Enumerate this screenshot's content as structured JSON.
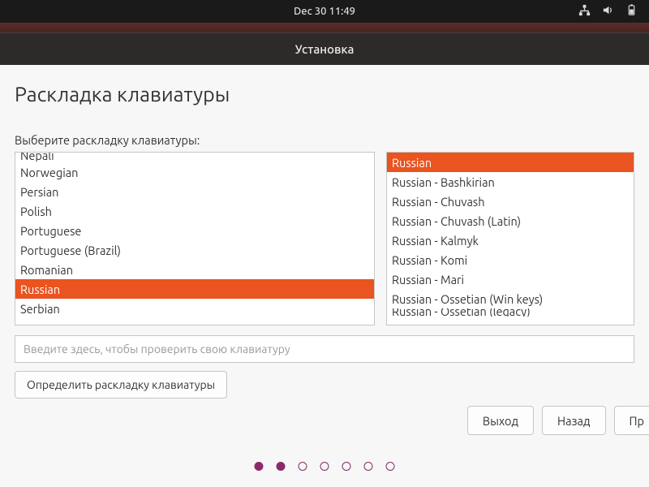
{
  "topbar": {
    "datetime": "Dec 30  11:49"
  },
  "window": {
    "title": "Установка"
  },
  "page": {
    "title": "Раскладка клавиатуры",
    "prompt": "Выберите раскладку клавиатуры:"
  },
  "left_list": {
    "selected_index": 7,
    "items": [
      "Nepali",
      "Norwegian",
      "Persian",
      "Polish",
      "Portuguese",
      "Portuguese (Brazil)",
      "Romanian",
      "Russian",
      "Serbian"
    ]
  },
  "right_list": {
    "selected_index": 0,
    "items": [
      "Russian",
      "Russian - Bashkirian",
      "Russian - Chuvash",
      "Russian - Chuvash (Latin)",
      "Russian - Kalmyk",
      "Russian - Komi",
      "Russian - Mari",
      "Russian - Ossetian (Win keys)",
      "Russian - Ossetian (legacy)"
    ]
  },
  "test_input": {
    "placeholder": "Введите здесь, чтобы проверить свою клавиатуру",
    "value": ""
  },
  "buttons": {
    "detect": "Определить раскладку клавиатуры",
    "quit": "Выход",
    "back": "Назад",
    "continue": "Пр"
  },
  "progress": {
    "total": 7,
    "current": 2
  }
}
